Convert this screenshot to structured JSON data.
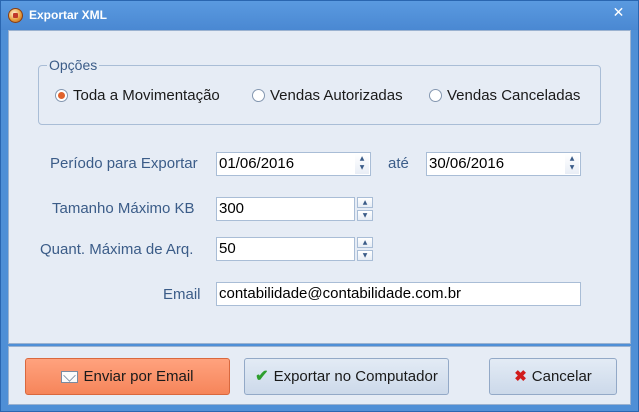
{
  "window": {
    "title": "Exportar XML",
    "close_glyph": "✕"
  },
  "options": {
    "group_title": "Opções",
    "radios": [
      {
        "label": "Toda a Movimentação",
        "checked": true
      },
      {
        "label": "Vendas Autorizadas",
        "checked": false
      },
      {
        "label": "Vendas Canceladas",
        "checked": false
      }
    ]
  },
  "form": {
    "period_label": "Período para Exportar",
    "date_from": "01/06/2016",
    "until_label": "até",
    "date_to": "30/06/2016",
    "max_size_label": "Tamanho Máximo KB",
    "max_size_value": "300",
    "max_files_label": "Quant. Máxima de Arq.",
    "max_files_value": "50",
    "email_label": "Email",
    "email_value": "contabilidade@contabilidade.com.br"
  },
  "buttons": {
    "send_email": "Enviar por Email",
    "export_computer": "Exportar no Computador",
    "cancel": "Cancelar"
  },
  "colors": {
    "title_bar": "#4f8fd6",
    "panel_bg": "#e6ecf5",
    "label_text": "#3b5c88",
    "email_button": "#f6855a",
    "radio_checked": "#e0622c"
  }
}
